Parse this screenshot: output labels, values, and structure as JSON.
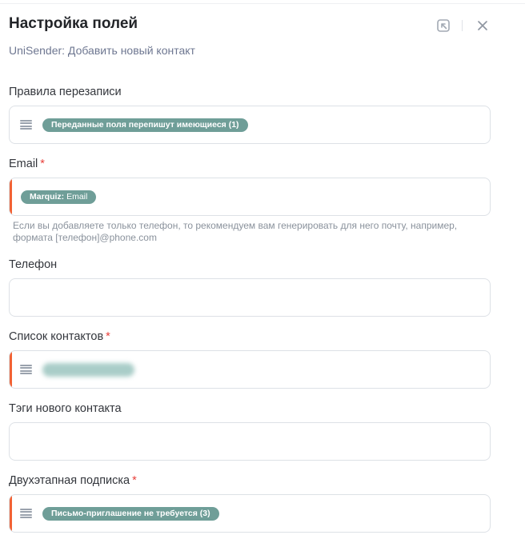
{
  "header": {
    "title": "Настройка полей",
    "subtitle": "UniSender: Добавить новый контакт",
    "icons": [
      "open-external-icon",
      "close-icon"
    ]
  },
  "fields": {
    "rewrite": {
      "label": "Правила перезаписи",
      "tag": "Переданные поля перепишут имеющиеся (1)"
    },
    "email": {
      "label": "Email",
      "required": "*",
      "tag_source": "Marquiz:",
      "tag_value": "Email",
      "hint": "Если вы добавляете только телефон, то рекомендуем вам генерировать для него почту, например, формата [телефон]@phone.com"
    },
    "phone": {
      "label": "Телефон",
      "value": ""
    },
    "contact_list": {
      "label": "Список контактов",
      "required": "*",
      "tag": "Список контактов"
    },
    "tags": {
      "label": "Тэги нового контакта",
      "value": ""
    },
    "double_optin": {
      "label": "Двухэтапная подписка",
      "required": "*",
      "tag": "Письмо-приглашение не требуется (3)"
    }
  },
  "colors": {
    "accent_tag": "#6f9e98",
    "required_marker": "#f26234",
    "required_star": "#e8403b"
  }
}
